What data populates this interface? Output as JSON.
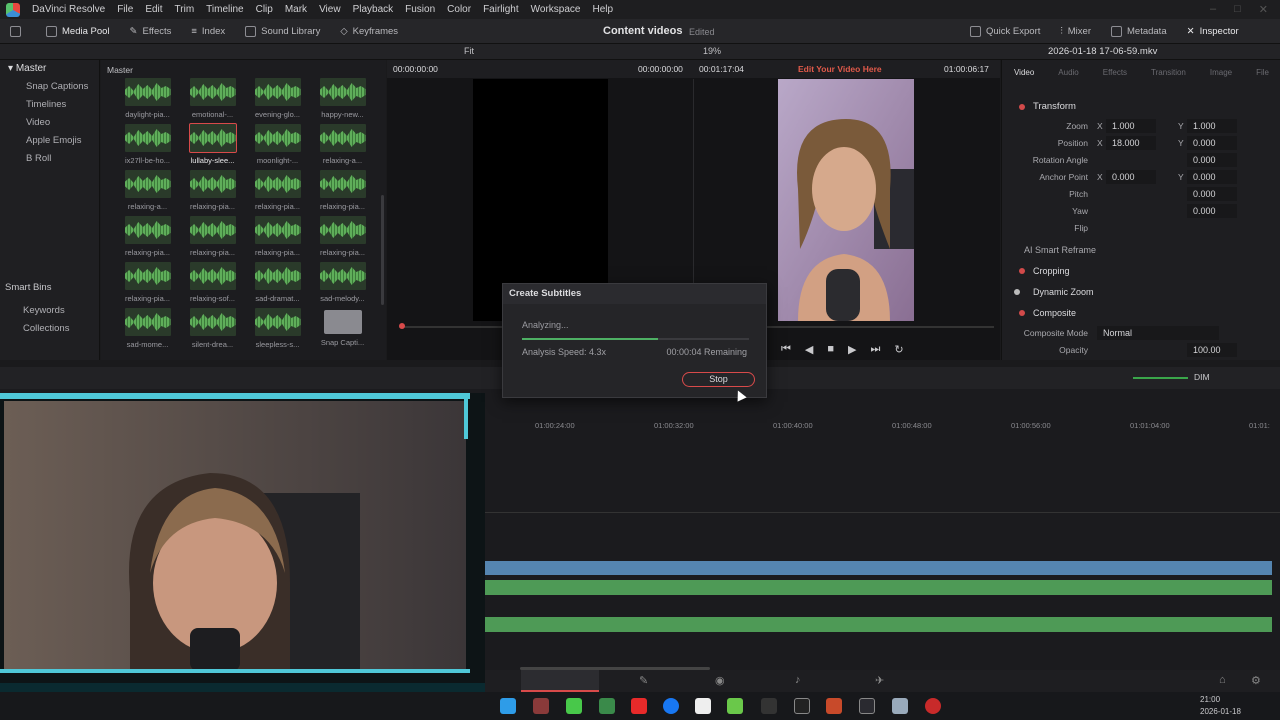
{
  "app": {
    "name": "DaVinci Resolve"
  },
  "menu": [
    "File",
    "Edit",
    "Trim",
    "Timeline",
    "Clip",
    "Mark",
    "View",
    "Playback",
    "Fusion",
    "Color",
    "Fairlight",
    "Workspace",
    "Help"
  ],
  "toolbar": {
    "media_pool": "Media Pool",
    "effects": "Effects",
    "index": "Index",
    "sound_library": "Sound Library",
    "keyframes": "Keyframes",
    "project_title": "Content videos",
    "project_status": "Edited",
    "quick_export": "Quick Export",
    "mixer": "Mixer",
    "metadata": "Metadata",
    "inspector": "Inspector"
  },
  "subbar": {
    "fit": "Fit",
    "zoom": "19%",
    "clip_name": "2026-01-18 17-06-59.mkv"
  },
  "left_panel": {
    "master": "Master",
    "items": [
      "Snap Captions",
      "Timelines",
      "Video",
      "Apple Emojis",
      "B Roll"
    ],
    "smart_bins": "Smart Bins",
    "smart_items": [
      "Keywords",
      "Collections"
    ]
  },
  "media_pool": {
    "header": "Master",
    "clips": [
      "daylight-pia...",
      "emotional-...",
      "evening-glo...",
      "happy-new...",
      "ix27ll-be-ho...",
      "lullaby-slee...",
      "moonlight-...",
      "relaxing-a...",
      "relaxing-a...",
      "relaxing-pia...",
      "relaxing-pia...",
      "relaxing-pia...",
      "relaxing-pia...",
      "relaxing-pia...",
      "relaxing-pia...",
      "relaxing-pia...",
      "relaxing-pia...",
      "relaxing-sof...",
      "sad-dramat...",
      "sad-melody...",
      "sad-mome...",
      "silent-drea...",
      "sleepless-s...",
      "Snap Capti..."
    ]
  },
  "viewer": {
    "src_tc": "00:00:00:00",
    "src_dur": "00:00:00:00",
    "rec_dur": "00:01:17:04",
    "title": "Edit Your Video Here",
    "rec_tc": "01:00:06:17"
  },
  "inspector": {
    "tabs": [
      "Video",
      "Audio",
      "Effects",
      "Transition",
      "Image",
      "File"
    ],
    "transform": "Transform",
    "zoom_label": "Zoom",
    "zoom_x": "1.000",
    "zoom_y": "1.000",
    "position_label": "Position",
    "pos_x": "18.000",
    "pos_y": "0.000",
    "rotation_label": "Rotation Angle",
    "rotation": "0.000",
    "anchor_label": "Anchor Point",
    "anchor_x": "0.000",
    "anchor_y": "0.000",
    "pitch_label": "Pitch",
    "pitch": "0.000",
    "yaw_label": "Yaw",
    "yaw": "0.000",
    "flip_label": "Flip",
    "ai_reframe": "AI Smart Reframe",
    "cropping": "Cropping",
    "dynamic_zoom": "Dynamic Zoom",
    "composite": "Composite",
    "composite_mode_label": "Composite Mode",
    "composite_mode": "Normal",
    "opacity_label": "Opacity",
    "opacity": "100.00",
    "x": "X",
    "y": "Y"
  },
  "dialog": {
    "title": "Create Subtitles",
    "status": "Analyzing...",
    "speed": "Analysis Speed: 4.3x",
    "remaining": "00:00:04 Remaining",
    "stop": "Stop",
    "progress": 0.6
  },
  "timeline": {
    "ruler": [
      "01:00:24:00",
      "01:00:32:00",
      "01:00:40:00",
      "01:00:48:00",
      "01:00:56:00",
      "01:01:04:00",
      "01:01:"
    ],
    "dim": "DIM"
  },
  "clock": {
    "time": "21:00",
    "date": "2026-01-18"
  },
  "colors": {
    "accent_red": "#d24a4a",
    "audio_green": "#4e9a56",
    "video_blue": "#5585b0"
  }
}
